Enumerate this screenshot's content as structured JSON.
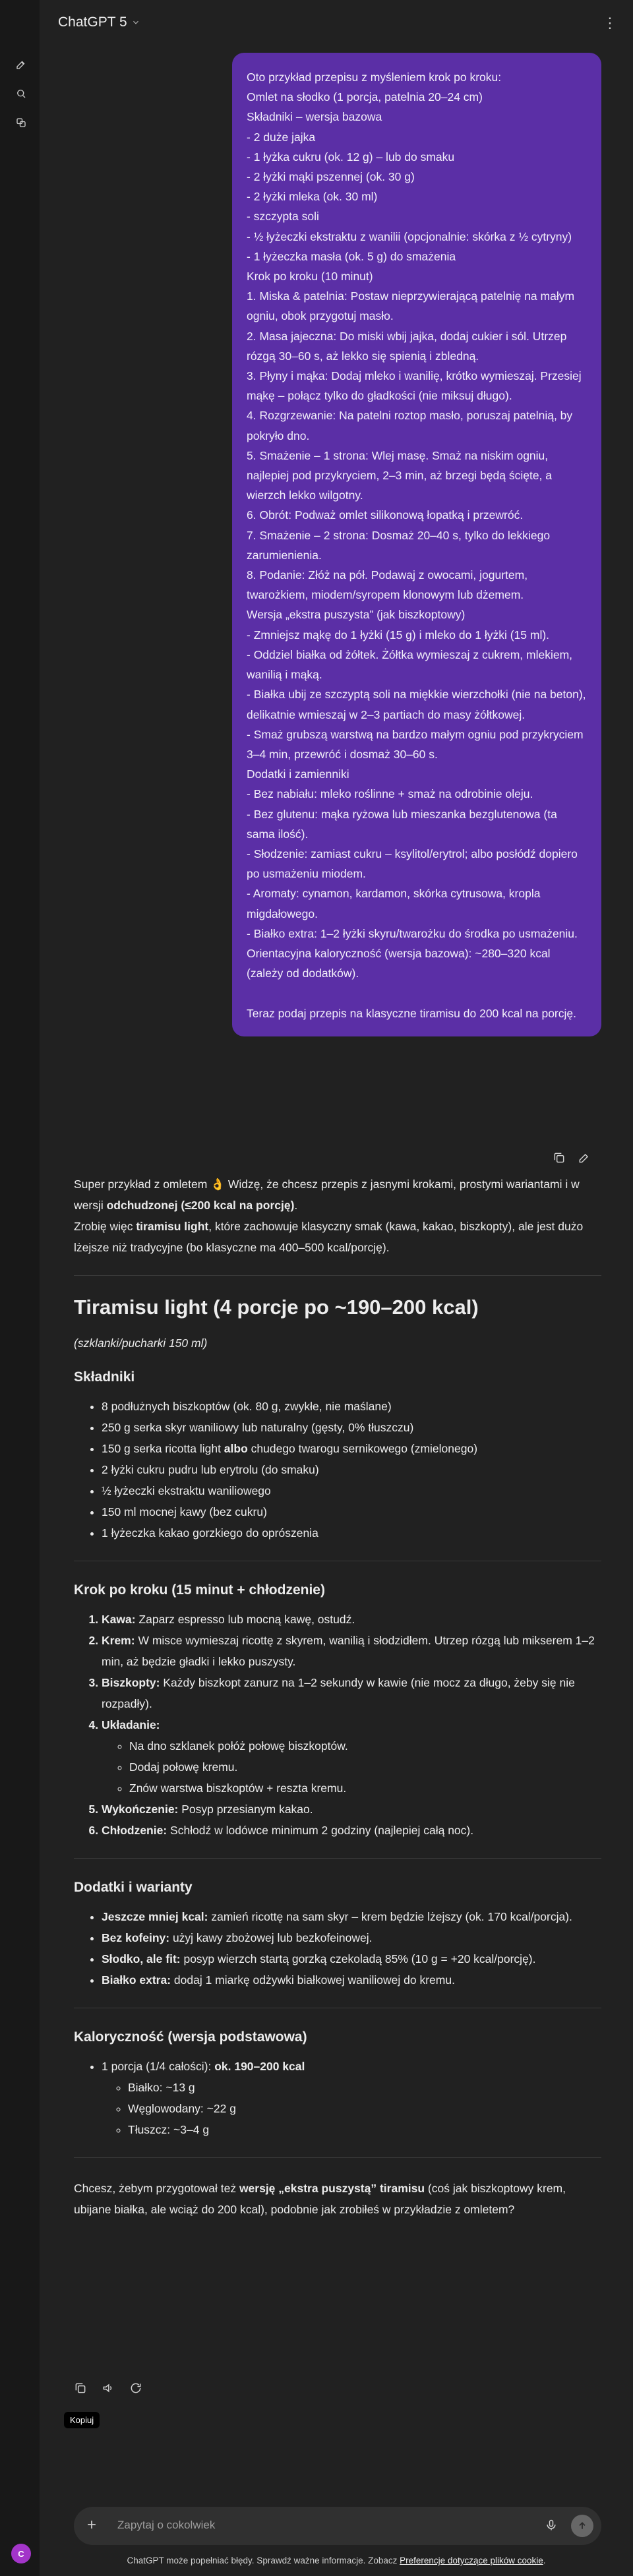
{
  "app": {
    "model_name": "ChatGPT 5"
  },
  "sidebar": {
    "icons": [
      "new-chat-icon",
      "search-icon",
      "library-icon"
    ],
    "avatar_initial": "C"
  },
  "user_message": {
    "lines": [
      "Oto przykład przepisu z myśleniem krok po kroku:",
      "Omlet na słodko (1 porcja, patelnia 20–24 cm)",
      "Składniki – wersja bazowa",
      "- 2 duże jajka",
      "- 1 łyżka cukru (ok. 12 g) – lub do smaku",
      "- 2 łyżki mąki pszennej (ok. 30 g)",
      "- 2 łyżki mleka (ok. 30 ml)",
      "- szczypta soli",
      "- ½ łyżeczki ekstraktu z wanilii (opcjonalnie: skórka z ½ cytryny)",
      "- 1 łyżeczka masła (ok. 5 g) do smażenia",
      "Krok po kroku (10 minut)",
      "1. Miska & patelnia: Postaw nieprzywierającą patelnię na małym ogniu, obok przygotuj masło.",
      "2. Masa jajeczna: Do miski wbij jajka, dodaj cukier i sól. Utrzep rózgą 30–60 s, aż lekko się spienią i zbledną.",
      "3. Płyny i mąka: Dodaj mleko i wanilię, krótko wymieszaj. Przesiej mąkę – połącz tylko do gładkości (nie miksuj długo).",
      "4. Rozgrzewanie: Na patelni roztop masło, poruszaj patelnią, by pokryło dno.",
      "5. Smażenie – 1 strona: Wlej masę. Smaż na niskim ogniu, najlepiej pod przykryciem, 2–3 min, aż brzegi będą ścięte, a wierzch lekko wilgotny.",
      "6. Obrót: Podważ omlet silikonową łopatką i przewróć.",
      "7. Smażenie – 2 strona: Dosmaż 20–40 s, tylko do lekkiego zarumienienia.",
      "8. Podanie: Złóż na pół. Podawaj z owocami, jogurtem, twarożkiem, miodem/syropem klonowym lub dżemem.",
      "Wersja „ekstra puszysta” (jak biszkoptowy)",
      "- Zmniejsz mąkę do 1 łyżki (15 g) i mleko do 1 łyżki (15 ml).",
      "- Oddziel białka od żółtek. Żółtka wymieszaj z cukrem, mlekiem, wanilią i mąką.",
      "- Białka ubij ze szczyptą soli na miękkie wierzchołki (nie na beton), delikatnie wmieszaj w 2–3 partiach do masy żółtkowej.",
      "- Smaż grubszą warstwą na bardzo małym ogniu pod przykryciem 3–4 min, przewróć i dosmaż 30–60 s.",
      "Dodatki i zamienniki",
      "- Bez nabiału: mleko roślinne + smaż na odrobinie oleju.",
      "- Bez glutenu: mąka ryżowa lub mieszanka bezglutenowa (ta sama ilość).",
      "- Słodzenie: zamiast cukru – ksylitol/erytrol; albo posłódź dopiero po usmażeniu miodem.",
      "- Aromaty: cynamon, kardamon, skórka cytrusowa, kropla migdałowego.",
      "- Białko extra: 1–2 łyżki skyru/twarożku do środka po usmażeniu.",
      "Orientacyjna kaloryczność (wersja bazowa): ~280–320 kcal (zależy od dodatków).",
      "",
      "Teraz podaj przepis na klasyczne tiramisu do 200 kcal na porcję."
    ],
    "actions": [
      "copy-icon",
      "edit-icon"
    ]
  },
  "answer": {
    "intro_1a": "Super przykład z omletem 👌 Widzę, że chcesz przepis z jasnymi krokami, prostymi wariantami i w wersji ",
    "intro_1b": "odchudzonej (≤200 kcal na porcję)",
    "intro_1c": ".",
    "intro_2a": "Zrobię więc ",
    "intro_2b": "tiramisu light",
    "intro_2c": ", które zachowuje klasyczny smak (kawa, kakao, biszkopty), ale jest dużo lżejsze niż tradycyjne (bo klasyczne ma 400–500 kcal/porcję).",
    "title": "Tiramisu light (4 porcje po ~190–200 kcal)",
    "subtitle": "(szklanki/pucharki 150 ml)",
    "ingredients_title": "Składniki",
    "ingredients": [
      "8 podłużnych biszkoptów (ok. 80 g, zwykłe, nie maślane)",
      "250 g serka skyr waniliowy lub naturalny (gęsty, 0% tłuszczu)",
      "150 g serka ricotta light albo chudego twarogu sernikowego (zmielonego)",
      "2 łyżki cukru pudru lub erytrolu (do smaku)",
      "½ łyżeczki ekstraktu waniliowego",
      "150 ml mocnej kawy (bez cukru)",
      "1 łyżeczka kakao gorzkiego do oprószenia"
    ],
    "ingredient_3_pre": "150 g serka ricotta light ",
    "ingredient_3_bold": "albo",
    "ingredient_3_post": " chudego twarogu sernikowego (zmielonego)",
    "steps_title": "Krok po kroku (15 minut + chłodzenie)",
    "steps": [
      {
        "label": "Kawa:",
        "text": " Zaparz espresso lub mocną kawę, ostudź."
      },
      {
        "label": "Krem:",
        "text": " W misce wymieszaj ricottę z skyrem, wanilią i słodzidłem. Utrzep rózgą lub mikserem 1–2 min, aż będzie gładki i lekko puszysty."
      },
      {
        "label": "Biszkopty:",
        "text": " Każdy biszkopt zanurz na 1–2 sekundy w kawie (nie mocz za długo, żeby się nie rozpadły)."
      },
      {
        "label": "Układanie:",
        "text": ""
      },
      {
        "label": "Wykończenie:",
        "text": " Posyp przesianym kakao."
      },
      {
        "label": "Chłodzenie:",
        "text": " Schłodź w lodówce minimum 2 godziny (najlepiej całą noc)."
      }
    ],
    "layering": [
      "Na dno szklanek połóż połowę biszkoptów.",
      "Dodaj połowę kremu.",
      "Znów warstwa biszkoptów + reszta kremu."
    ],
    "extras_title": "Dodatki i warianty",
    "extras": [
      {
        "label": "Jeszcze mniej kcal:",
        "text": " zamień ricottę na sam skyr – krem będzie lżejszy (ok. 170 kcal/porcja)."
      },
      {
        "label": "Bez kofeiny:",
        "text": " użyj kawy zbożowej lub bezkofeinowej."
      },
      {
        "label": "Słodko, ale fit:",
        "text": " posyp wierzch startą gorzką czekoladą 85% (10 g = +20 kcal/porcję)."
      },
      {
        "label": "Białko extra:",
        "text": " dodaj 1 miarkę odżywki białkowej waniliowej do kremu."
      }
    ],
    "calories_title": "Kaloryczność (wersja podstawowa)",
    "calories_main_pre": "1 porcja (1/4 całości): ",
    "calories_main_bold": "ok. 190–200 kcal",
    "macros": [
      "Białko: ~13 g",
      "Węglowodany: ~22 g",
      "Tłuszcz: ~3–4 g"
    ],
    "outro_a": "Chcesz, żebym przygotował też ",
    "outro_b": "wersję „ekstra puszystą” tiramisu",
    "outro_c": " (coś jak biszkoptowy krem, ubijane białka, ale wciąż do 200 kcal), podobnie jak zrobiłeś w przykładzie z omletem?",
    "actions": [
      "copy-icon",
      "speaker-icon",
      "regenerate-icon"
    ],
    "tooltip": "Kopiuj"
  },
  "composer": {
    "placeholder": "Zapytaj o cokolwiek"
  },
  "footer": {
    "text_pre": "ChatGPT może popełniać błędy. Sprawdź ważne informacje. Zobacz ",
    "link": "Preferencje dotyczące plików cookie",
    "text_post": "."
  }
}
